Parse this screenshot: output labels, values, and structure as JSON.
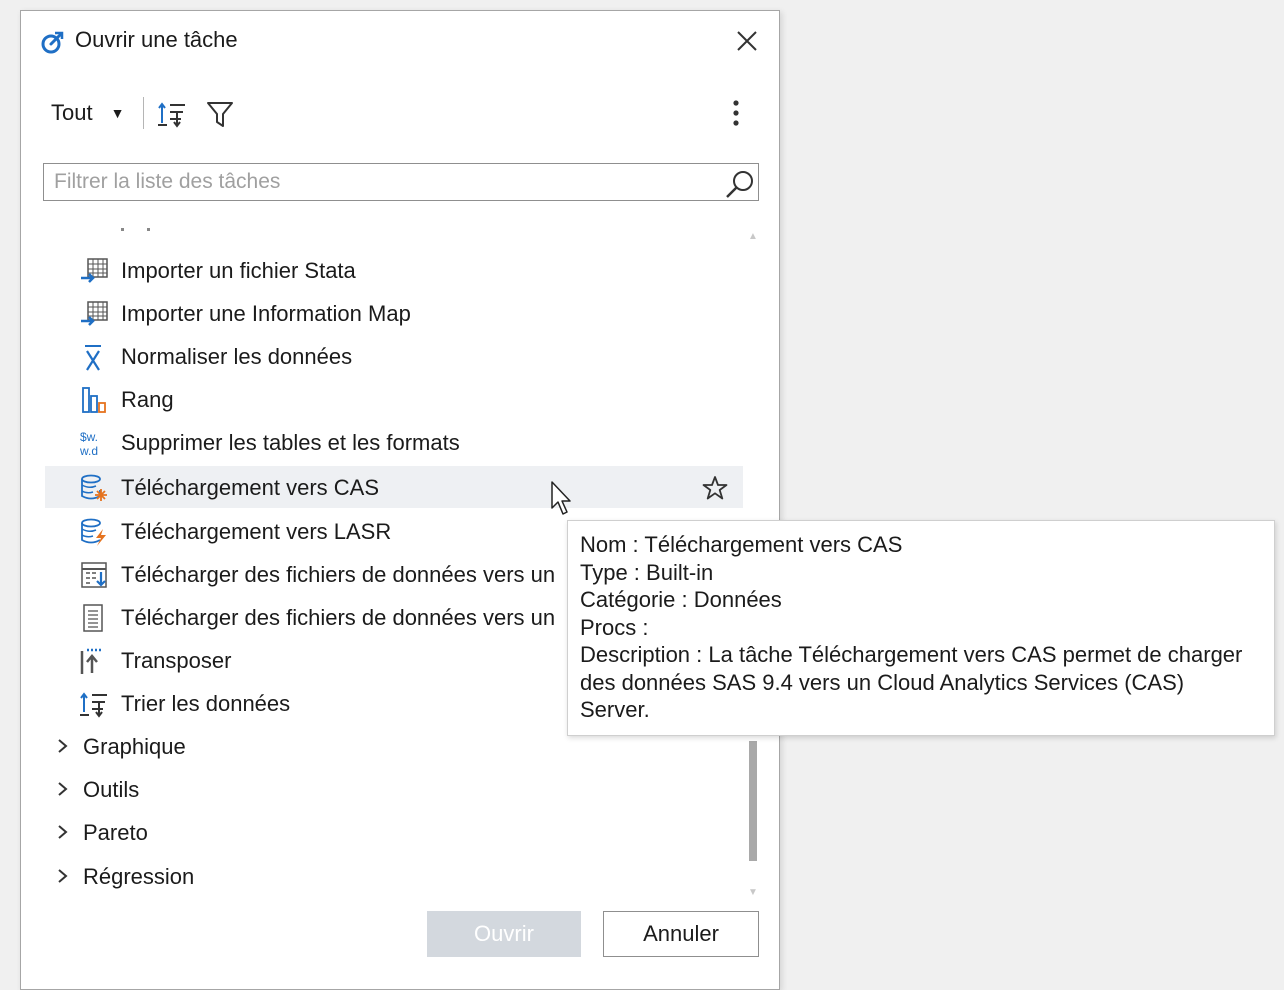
{
  "dialog": {
    "title": "Ouvrir une tâche",
    "toolbar": {
      "scope_label": "Tout"
    },
    "search": {
      "placeholder": "Filtrer la liste des tâches",
      "value": ""
    },
    "tasks": [
      {
        "label": "Importer un fichier Stata",
        "icon": "import-table-icon"
      },
      {
        "label": "Importer une Information Map",
        "icon": "import-table-icon"
      },
      {
        "label": "Normaliser les données",
        "icon": "x-bar-icon"
      },
      {
        "label": "Rang",
        "icon": "rank-bars-icon"
      },
      {
        "label": "Supprimer les tables et les formats",
        "icon": "format-sw-icon"
      },
      {
        "label": "Téléchargement vers CAS",
        "icon": "cas-upload-icon",
        "selected": true
      },
      {
        "label": "Téléchargement vers LASR",
        "icon": "lasr-upload-icon"
      },
      {
        "label": "Télécharger des fichiers de données vers un",
        "icon": "upload-grid-icon"
      },
      {
        "label": "Télécharger des fichiers de données vers un",
        "icon": "document-icon"
      },
      {
        "label": "Transposer",
        "icon": "transpose-icon"
      },
      {
        "label": "Trier les données",
        "icon": "sort-icon"
      }
    ],
    "categories": [
      {
        "label": "Graphique"
      },
      {
        "label": "Outils"
      },
      {
        "label": "Pareto"
      },
      {
        "label": "Régression"
      }
    ],
    "buttons": {
      "open": "Ouvrir",
      "cancel": "Annuler"
    }
  },
  "tooltip": {
    "lines": [
      "Nom : Téléchargement vers CAS",
      "Type : Built-in",
      "Catégorie : Données",
      "Procs :",
      "Description : La tâche Téléchargement vers CAS permet de charger",
      "des données SAS 9.4 vers un Cloud Analytics Services (CAS)",
      "Server."
    ]
  },
  "colors": {
    "accent_blue": "#1f6fc5",
    "accent_orange": "#e5731f",
    "selected_row": "#eef0f3",
    "disabled_button": "#d3d8de"
  }
}
